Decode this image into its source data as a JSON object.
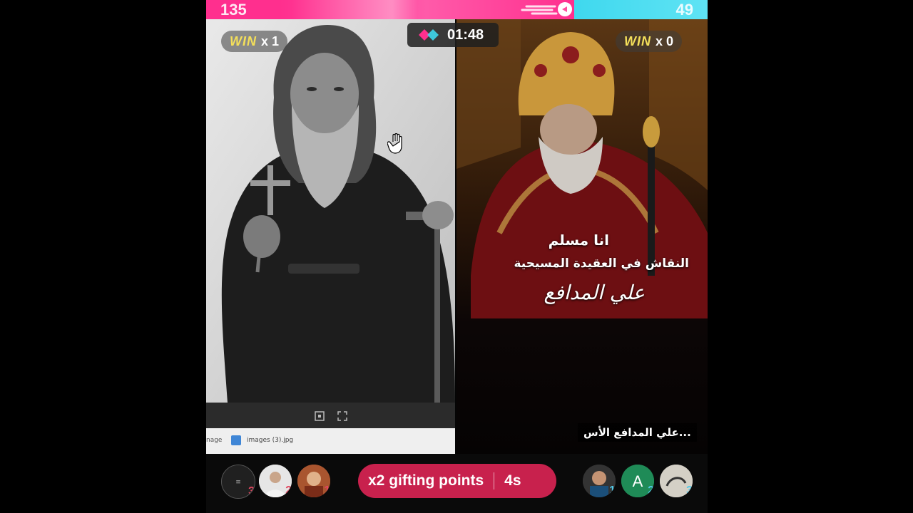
{
  "battle": {
    "left_score": "135",
    "right_score": "49",
    "timer": "01:48",
    "left_win_label": "WIN",
    "left_win_count": "x 1",
    "right_win_label": "WIN",
    "right_win_count": "x 0",
    "score_share_left": 0.734,
    "colors": {
      "left": "#ff2f8e",
      "right": "#3fd8ee",
      "gift": "#c8214d",
      "win": "#f4df5a"
    }
  },
  "left_panel": {
    "file_prefix": "nage",
    "file_name": "images (3).jpg"
  },
  "right_panel": {
    "line1": "انا مسلم",
    "line2": "النقاش في العقيدة المسيحية",
    "line3": "علي المدافع",
    "caption": "علي المدافع الأس..."
  },
  "gift": {
    "label": "x2 gifting points",
    "seconds": "4s"
  },
  "left_supporters": [
    {
      "rank": "3",
      "color": "#e2455f"
    },
    {
      "rank": "2",
      "color": "#e2455f"
    },
    {
      "rank": "1",
      "color": "#e2455f"
    }
  ],
  "right_supporters": [
    {
      "rank": "1",
      "color": "#52c8e6",
      "icon": "avatar"
    },
    {
      "rank": "2",
      "color": "#52c8e6",
      "letter": "A"
    },
    {
      "rank": "3",
      "color": "#52c8e6",
      "icon": "avatar"
    }
  ]
}
